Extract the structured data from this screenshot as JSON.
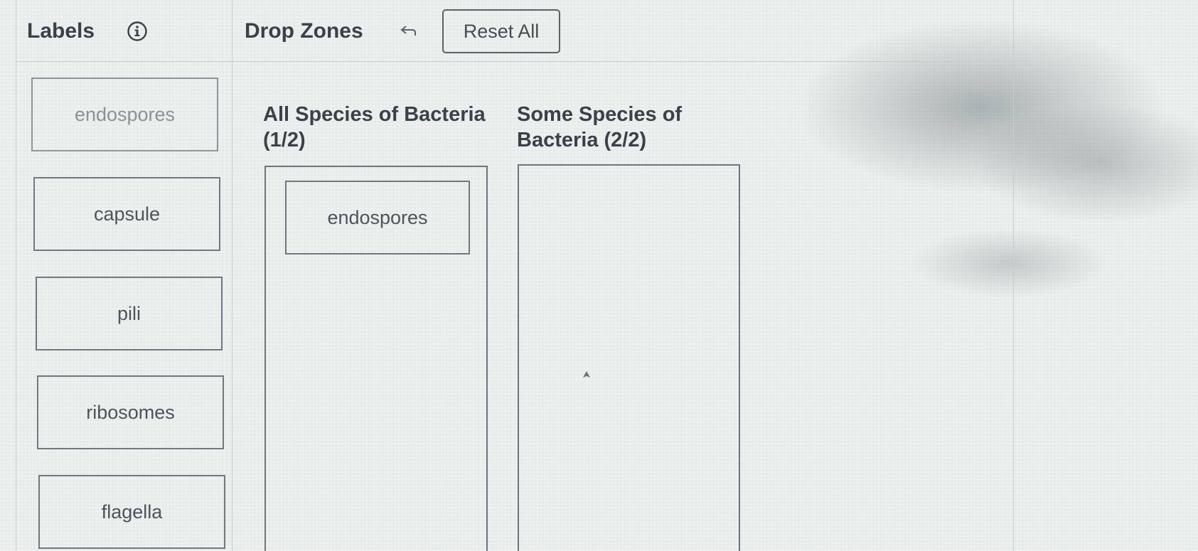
{
  "header": {
    "labels_title": "Labels",
    "drop_zones_title": "Drop Zones",
    "reset_label": "Reset All",
    "info_icon": "info-circle-icon",
    "undo_icon": "undo-arrow-icon"
  },
  "labels": [
    {
      "text": "endospores",
      "used": true
    },
    {
      "text": "capsule",
      "used": false
    },
    {
      "text": "pili",
      "used": false
    },
    {
      "text": "ribosomes",
      "used": false
    },
    {
      "text": "flagella",
      "used": false
    }
  ],
  "zones": [
    {
      "title": "All Species of Bacteria (1/2)",
      "placed": [
        "endospores"
      ]
    },
    {
      "title": "Some Species of Bacteria (2/2)",
      "placed": []
    }
  ],
  "colors": {
    "background": "#e6ebe9",
    "border": "#707880",
    "text": "#3a4149"
  }
}
